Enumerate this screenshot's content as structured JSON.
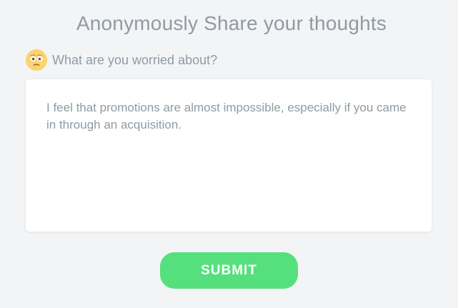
{
  "header": {
    "title": "Anonymously Share your thoughts"
  },
  "prompt": {
    "icon": "worried-face-icon",
    "question": "What are you worried about?"
  },
  "response": {
    "text": "I feel that promotions are almost impossible, especially if you came in through an acquisition."
  },
  "actions": {
    "submit_label": "SUBMIT"
  },
  "colors": {
    "background": "#f3f4f6",
    "text_muted": "#8f9ba4",
    "accent": "#56e07d",
    "emoji": "#fbd36f"
  }
}
